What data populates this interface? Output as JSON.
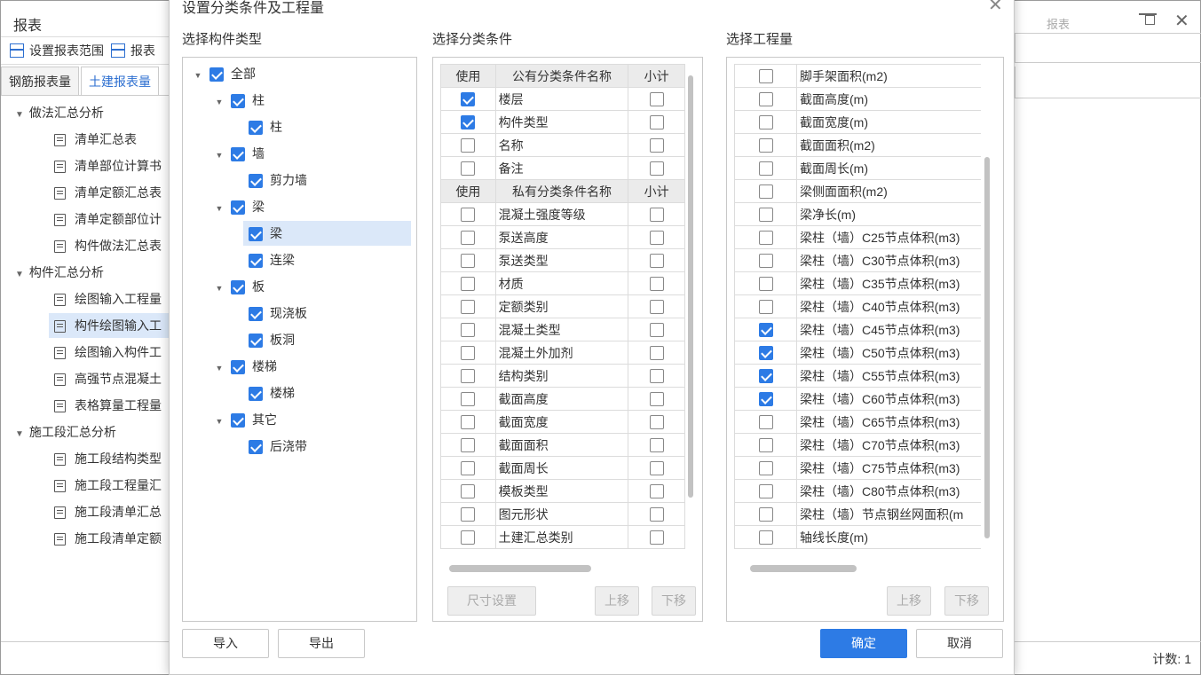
{
  "bg": {
    "title": "报表",
    "toolbar": {
      "set_range": "设置报表范围",
      "report": "报表"
    },
    "tabs": [
      "钢筋报表量",
      "土建报表量"
    ],
    "tree": [
      {
        "label": "做法汇总分析",
        "level": 0
      },
      {
        "label": "清单汇总表",
        "level": 1
      },
      {
        "label": "清单部位计算书",
        "level": 1
      },
      {
        "label": "清单定额汇总表",
        "level": 1
      },
      {
        "label": "清单定额部位计",
        "level": 1
      },
      {
        "label": "构件做法汇总表",
        "level": 1
      },
      {
        "label": "构件汇总分析",
        "level": 0
      },
      {
        "label": "绘图输入工程量",
        "level": 1
      },
      {
        "label": "构件绘图输入工",
        "level": 1,
        "selected": true
      },
      {
        "label": "绘图输入构件工",
        "level": 1
      },
      {
        "label": "高强节点混凝土",
        "level": 1
      },
      {
        "label": "表格算量工程量",
        "level": 1
      },
      {
        "label": "施工段汇总分析",
        "level": 0
      },
      {
        "label": "施工段结构类型",
        "level": 1
      },
      {
        "label": "施工段工程量汇",
        "level": 1
      },
      {
        "label": "施工段清单汇总",
        "level": 1
      },
      {
        "label": "施工段清单定额",
        "level": 1
      }
    ],
    "top_right": "报表",
    "count_label": "计数: 1"
  },
  "dialog": {
    "title": "设置分类条件及工程量",
    "section_component": "选择构件类型",
    "section_condition": "选择分类条件",
    "section_quantity": "选择工程量",
    "component_tree": [
      {
        "label": "全部",
        "level": 0,
        "checked": true,
        "expand": true
      },
      {
        "label": "柱",
        "level": 1,
        "checked": true,
        "expand": true
      },
      {
        "label": "柱",
        "level": 2,
        "checked": true
      },
      {
        "label": "墙",
        "level": 1,
        "checked": true,
        "expand": true
      },
      {
        "label": "剪力墙",
        "level": 2,
        "checked": true
      },
      {
        "label": "梁",
        "level": 1,
        "checked": true,
        "expand": true
      },
      {
        "label": "梁",
        "level": 2,
        "checked": true,
        "selected": true
      },
      {
        "label": "连梁",
        "level": 2,
        "checked": true
      },
      {
        "label": "板",
        "level": 1,
        "checked": true,
        "expand": true
      },
      {
        "label": "现浇板",
        "level": 2,
        "checked": true
      },
      {
        "label": "板洞",
        "level": 2,
        "checked": true
      },
      {
        "label": "楼梯",
        "level": 1,
        "checked": true,
        "expand": true
      },
      {
        "label": "楼梯",
        "level": 2,
        "checked": true
      },
      {
        "label": "其它",
        "level": 1,
        "checked": true,
        "expand": true
      },
      {
        "label": "后浇带",
        "level": 2,
        "checked": true
      }
    ],
    "public_header": {
      "use": "使用",
      "name": "公有分类条件名称",
      "subtotal": "小计"
    },
    "public_rows": [
      {
        "use": true,
        "name": "楼层",
        "sub": false
      },
      {
        "use": true,
        "name": "构件类型",
        "sub": false
      },
      {
        "use": false,
        "name": "名称",
        "sub": false
      },
      {
        "use": false,
        "name": "备注",
        "sub": false
      }
    ],
    "private_header": {
      "use": "使用",
      "name": "私有分类条件名称",
      "subtotal": "小计"
    },
    "private_rows": [
      {
        "use": false,
        "name": "混凝土强度等级",
        "sub": false
      },
      {
        "use": false,
        "name": "泵送高度",
        "sub": false
      },
      {
        "use": false,
        "name": "泵送类型",
        "sub": false
      },
      {
        "use": false,
        "name": "材质",
        "sub": false
      },
      {
        "use": false,
        "name": "定额类别",
        "sub": false
      },
      {
        "use": false,
        "name": "混凝土类型",
        "sub": false
      },
      {
        "use": false,
        "name": "混凝土外加剂",
        "sub": false
      },
      {
        "use": false,
        "name": "结构类别",
        "sub": false
      },
      {
        "use": false,
        "name": "截面高度",
        "sub": false
      },
      {
        "use": false,
        "name": "截面宽度",
        "sub": false
      },
      {
        "use": false,
        "name": "截面面积",
        "sub": false
      },
      {
        "use": false,
        "name": "截面周长",
        "sub": false
      },
      {
        "use": false,
        "name": "模板类型",
        "sub": false
      },
      {
        "use": false,
        "name": "图元形状",
        "sub": false
      },
      {
        "use": false,
        "name": "土建汇总类别",
        "sub": false
      }
    ],
    "quantity_rows": [
      {
        "checked": false,
        "name": "脚手架面积(m2)"
      },
      {
        "checked": false,
        "name": "截面高度(m)"
      },
      {
        "checked": false,
        "name": "截面宽度(m)"
      },
      {
        "checked": false,
        "name": "截面面积(m2)"
      },
      {
        "checked": false,
        "name": "截面周长(m)"
      },
      {
        "checked": false,
        "name": "梁侧面面积(m2)"
      },
      {
        "checked": false,
        "name": "梁净长(m)"
      },
      {
        "checked": false,
        "name": "梁柱（墙）C25节点体积(m3)"
      },
      {
        "checked": false,
        "name": "梁柱（墙）C30节点体积(m3)"
      },
      {
        "checked": false,
        "name": "梁柱（墙）C35节点体积(m3)"
      },
      {
        "checked": false,
        "name": "梁柱（墙）C40节点体积(m3)"
      },
      {
        "checked": true,
        "name": "梁柱（墙）C45节点体积(m3)"
      },
      {
        "checked": true,
        "name": "梁柱（墙）C50节点体积(m3)"
      },
      {
        "checked": true,
        "name": "梁柱（墙）C55节点体积(m3)"
      },
      {
        "checked": true,
        "name": "梁柱（墙）C60节点体积(m3)"
      },
      {
        "checked": false,
        "name": "梁柱（墙）C65节点体积(m3)"
      },
      {
        "checked": false,
        "name": "梁柱（墙）C70节点体积(m3)"
      },
      {
        "checked": false,
        "name": "梁柱（墙）C75节点体积(m3)"
      },
      {
        "checked": false,
        "name": "梁柱（墙）C80节点体积(m3)"
      },
      {
        "checked": false,
        "name": "梁柱（墙）节点钢丝网面积(m"
      },
      {
        "checked": false,
        "name": "轴线长度(m)"
      }
    ],
    "buttons": {
      "size_setting": "尺寸设置",
      "move_up": "上移",
      "move_down": "下移",
      "import": "导入",
      "export": "导出",
      "ok": "确定",
      "cancel": "取消"
    },
    "colors": {
      "accent": "#2d7be5",
      "selection": "#dbe8f9"
    }
  }
}
